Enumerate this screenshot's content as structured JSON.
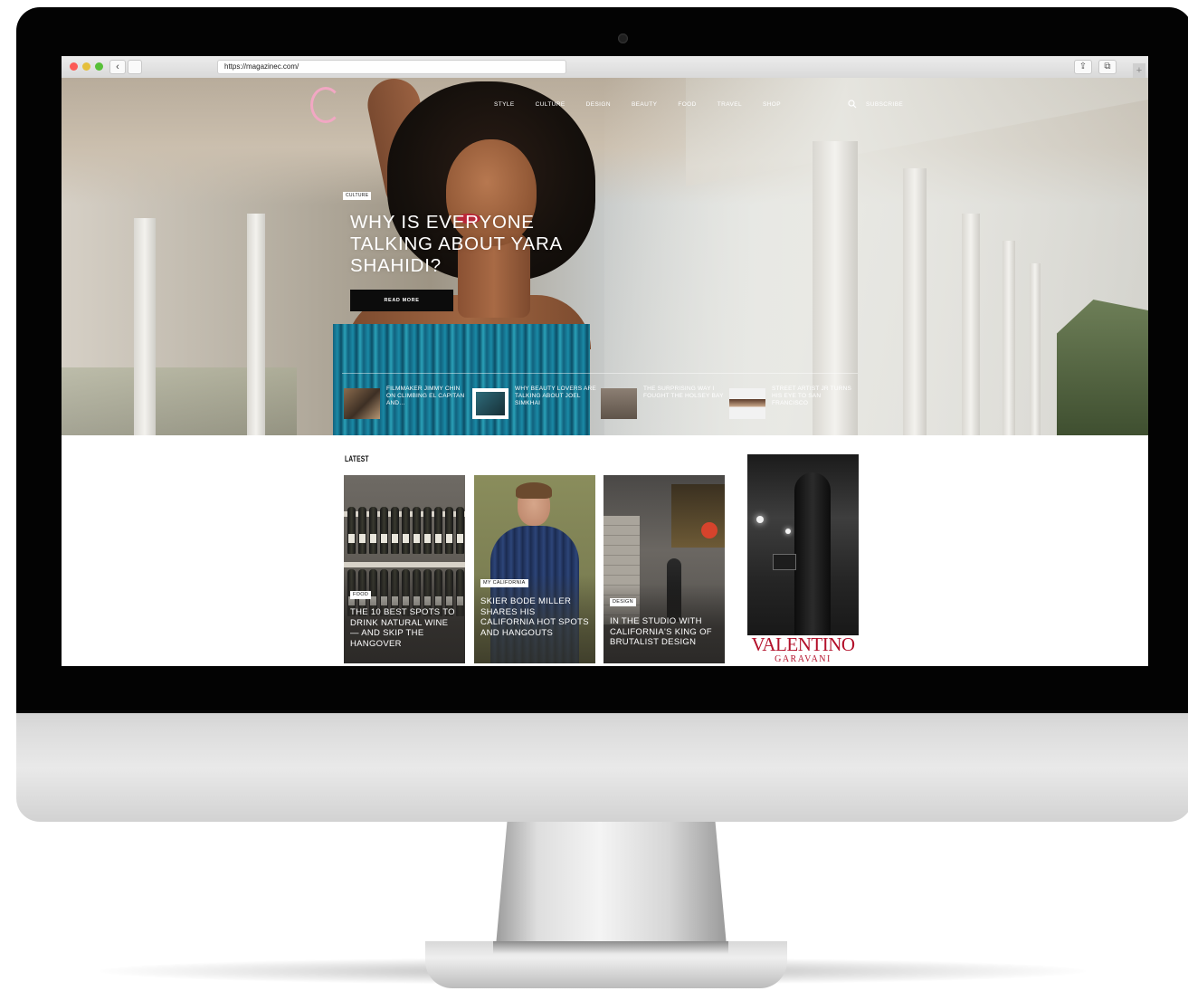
{
  "browser": {
    "url": "https://magazinec.com/",
    "back_glyph": "‹",
    "share_glyph": "⇪",
    "tabs_glyph": "⧉",
    "plus_glyph": "+"
  },
  "site": {
    "nav": [
      "STYLE",
      "CULTURE",
      "DESIGN",
      "BEAUTY",
      "FOOD",
      "TRAVEL",
      "SHOP"
    ],
    "subscribe": "SUBSCRIBE"
  },
  "hero": {
    "tag": "CULTURE",
    "title": "WHY IS EVERYONE TALKING ABOUT YARA SHAHIDI?",
    "cta": "READ MORE",
    "mini_stories": [
      "FILMMAKER JIMMY CHIN ON CLIMBING EL CAPITAN AND...",
      "WHY BEAUTY LOVERS ARE TALKING ABOUT JOEL SIMKHAI",
      "THE SURPRISING WAY I FOUGHT THE HOLSEY BAY",
      "STREET ARTIST JR TURNS HIS EYE TO SAN FRANCISCO"
    ]
  },
  "latest": {
    "heading": "LATEST",
    "cards": [
      {
        "tag": "FOOD",
        "title": "THE 10 BEST SPOTS TO DRINK NATURAL WINE — AND SKIP THE HANGOVER"
      },
      {
        "tag": "MY CALIFORNIA",
        "title": "SKIER BODE MILLER SHARES HIS CALIFORNIA HOT SPOTS AND HANGOUTS"
      },
      {
        "tag": "DESIGN",
        "title": "IN THE STUDIO WITH CALIFORNIA'S KING OF BRUTALIST DESIGN"
      }
    ]
  },
  "ad": {
    "brand": "VALENTINO",
    "sub": "GARAVANI"
  },
  "colors": {
    "logo_accent": "#f2a7c3",
    "ad_red": "#b3102a"
  }
}
